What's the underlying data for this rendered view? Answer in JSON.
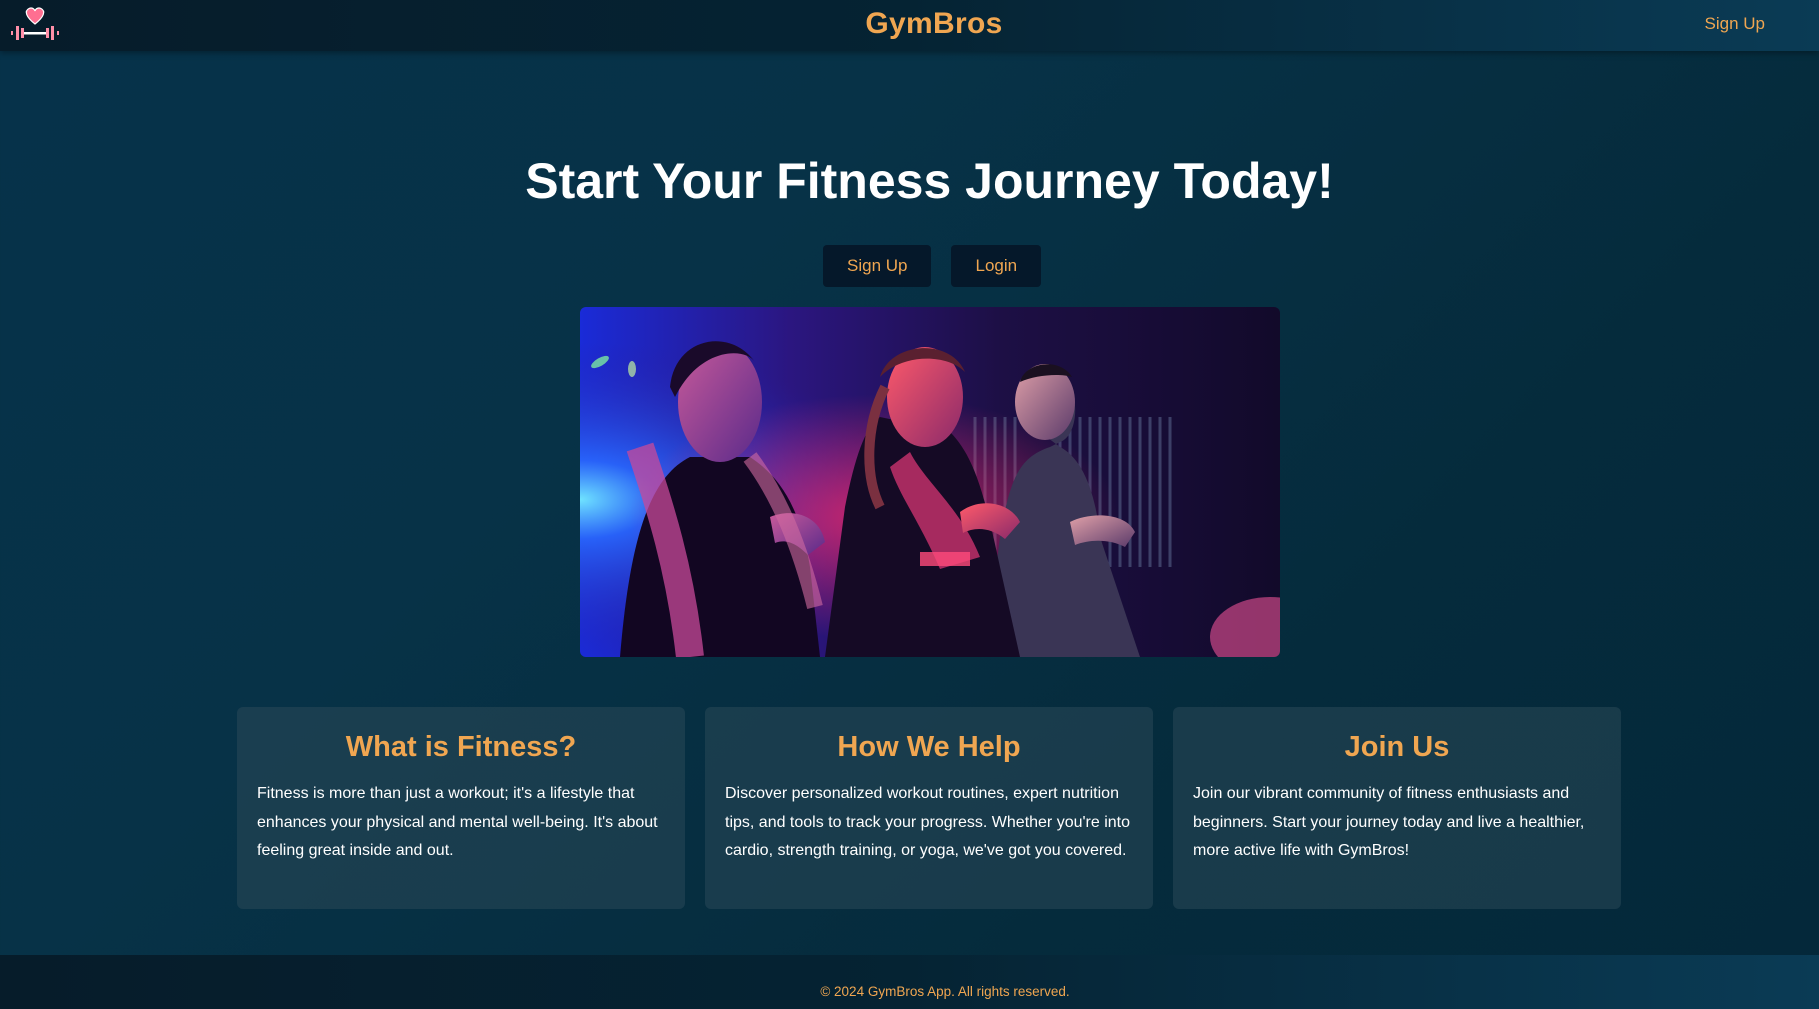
{
  "colors": {
    "accent": "#f0a651",
    "navbar": "#061c2a",
    "button_bg": "#05182a",
    "page_bg": "#06324a",
    "card_bg": "#2a4858",
    "logo_heart": "#ff6f91"
  },
  "header": {
    "logo_icon": "heart-dumbbell-icon",
    "brand": "GymBros",
    "nav_signup": "Sign Up"
  },
  "hero": {
    "title": "Start Your Fitness Journey Today!",
    "signup_label": "Sign Up",
    "login_label": "Login",
    "image_icon": "gym-runners-photo"
  },
  "cards": [
    {
      "title": "What is Fitness?",
      "text": "Fitness is more than just a workout; it's a lifestyle that enhances your physical and mental well-being. It's about feeling great inside and out."
    },
    {
      "title": "How We Help",
      "text": "Discover personalized workout routines, expert nutrition tips, and tools to track your progress. Whether you're into cardio, strength training, or yoga, we've got you covered."
    },
    {
      "title": "Join Us",
      "text": "Join our vibrant community of fitness enthusiasts and beginners. Start your journey today and live a healthier, more active life with GymBros!"
    }
  ],
  "footer": {
    "text": "© 2024 GymBros App. All rights reserved."
  }
}
